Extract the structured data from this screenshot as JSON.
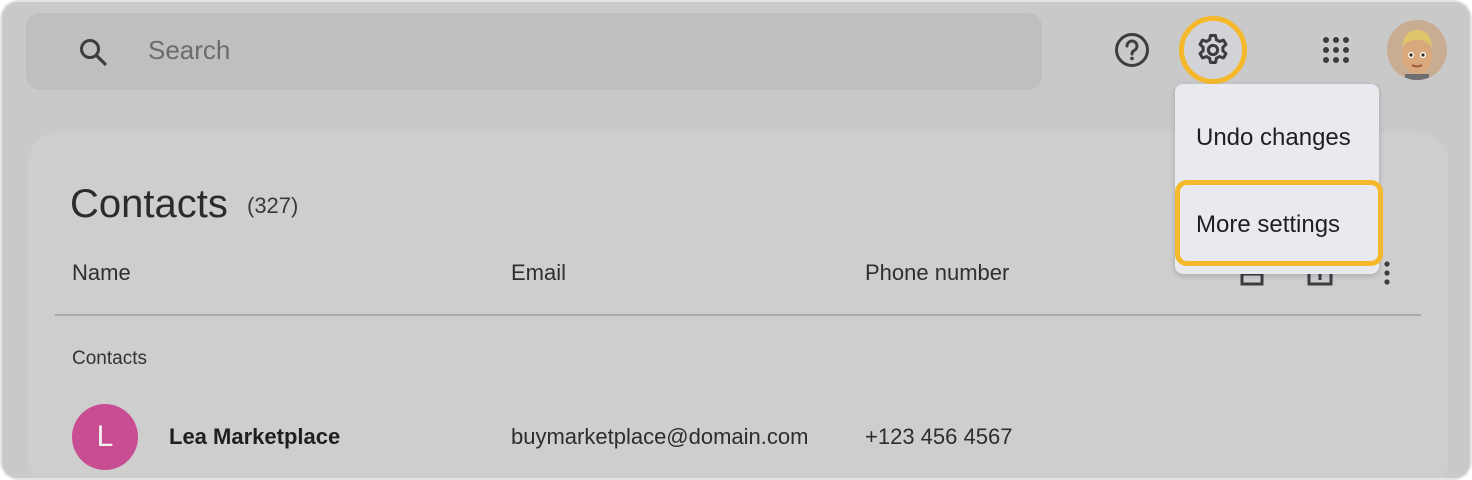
{
  "search": {
    "placeholder": "Search",
    "icon": "search-icon"
  },
  "toolbar": {
    "help_icon": "help-circle-icon",
    "settings_icon": "gear-icon",
    "apps_icon": "apps-grid-icon",
    "highlight_color": "#f5b82b"
  },
  "page": {
    "title": "Contacts",
    "count": "(327)"
  },
  "table": {
    "headers": {
      "name": "Name",
      "email": "Email",
      "phone": "Phone number"
    },
    "section": "Contacts",
    "rows": [
      {
        "initial": "L",
        "name": "Lea Marketplace",
        "email": "buymarketplace@domain.com",
        "phone": "+123 456 4567",
        "avatar_color": "#c94d92"
      }
    ]
  },
  "menu": {
    "items": [
      {
        "label": "Undo changes"
      },
      {
        "label": "More settings"
      }
    ]
  }
}
